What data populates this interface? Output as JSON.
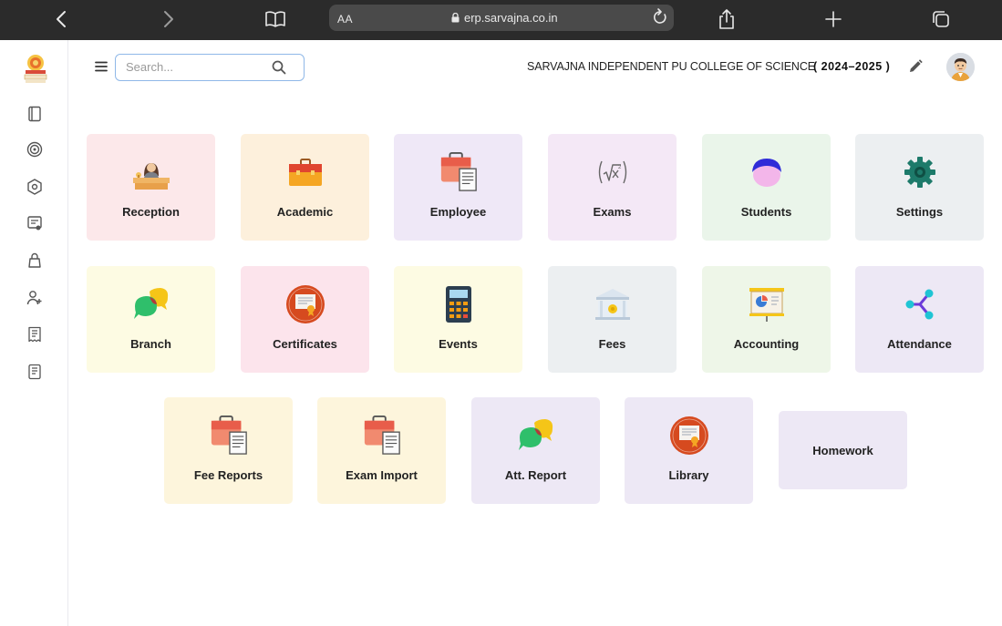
{
  "browser": {
    "aa_label": "AA",
    "url": "erp.sarvajna.co.in"
  },
  "header": {
    "search_placeholder": "Search...",
    "college_name": "SARVAJNA INDEPENDENT PU COLLEGE OF SCIENCE",
    "academic_year": "( 2024–2025 )"
  },
  "sidebar": {
    "icons": [
      "book-icon",
      "target-icon",
      "hexagon-icon",
      "report-icon",
      "bag-icon",
      "add-user-icon",
      "receipt-icon",
      "document-icon"
    ]
  },
  "tiles": [
    {
      "label": "Reception",
      "icon": "receptionist-icon",
      "color": "#fce8ea"
    },
    {
      "label": "Academic",
      "icon": "briefcase-icon",
      "color": "#fdf0dc"
    },
    {
      "label": "Employee",
      "icon": "employee-files-icon",
      "color": "#efe8f7"
    },
    {
      "label": "Exams",
      "icon": "formula-icon",
      "color": "#f4e8f6"
    },
    {
      "label": "Students",
      "icon": "student-icon",
      "color": "#eaf5ea"
    },
    {
      "label": "Settings",
      "icon": "gear-icon",
      "color": "#eceff1"
    },
    {
      "label": "Branch",
      "icon": "chat-bubbles-icon",
      "color": "#fdfbe3"
    },
    {
      "label": "Certificates",
      "icon": "certificate-icon",
      "color": "#fce4ec"
    },
    {
      "label": "Events",
      "icon": "calculator-icon",
      "color": "#fdfbe3"
    },
    {
      "label": "Fees",
      "icon": "bank-icon",
      "color": "#eceff1"
    },
    {
      "label": "Accounting",
      "icon": "presentation-icon",
      "color": "#eef6e8"
    },
    {
      "label": "Attendance",
      "icon": "share-icon",
      "color": "#ede8f5"
    },
    {
      "label": "Fee Reports",
      "icon": "fee-reports-icon",
      "color": "#fdf5dc"
    },
    {
      "label": "Exam Import",
      "icon": "exam-import-icon",
      "color": "#fdf5dc"
    },
    {
      "label": "Att. Report",
      "icon": "att-report-icon",
      "color": "#ede8f5"
    },
    {
      "label": "Library",
      "icon": "library-icon",
      "color": "#ede8f5"
    },
    {
      "label": "Homework",
      "icon": "",
      "color": "#ede8f5"
    }
  ]
}
